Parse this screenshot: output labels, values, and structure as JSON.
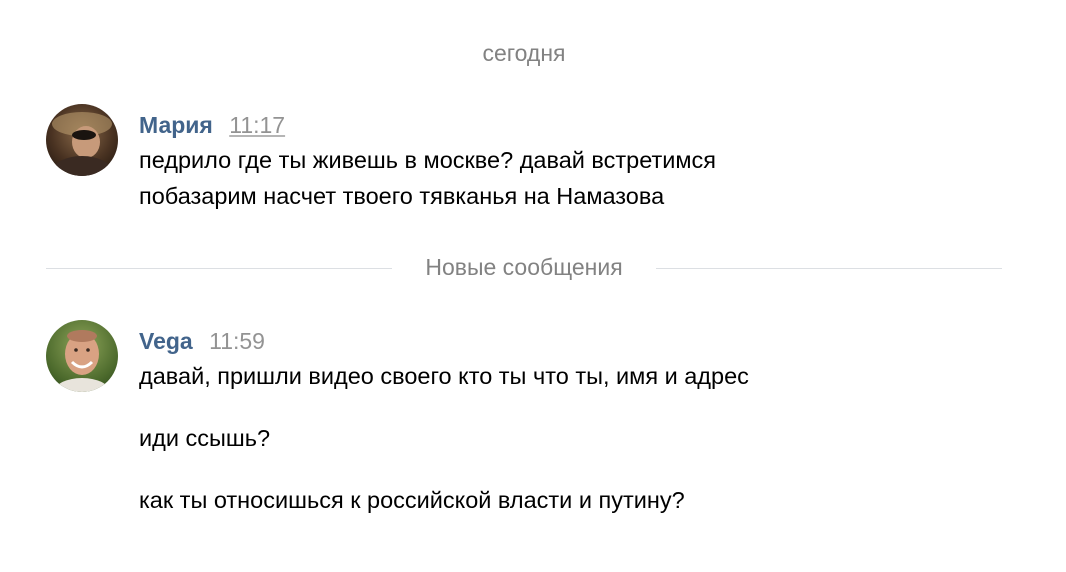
{
  "chat": {
    "date_divider": "сегодня",
    "new_messages_divider": "Новые сообщения",
    "messages": [
      {
        "author": "Мария",
        "time": "11:17",
        "lines": [
          "педрило где ты живешь в москве? давай встретимся",
          "побазарим насчет твоего тявканья на Намазова"
        ]
      },
      {
        "author": "Vega",
        "time": "11:59",
        "lines": [
          "давай, пришли видео своего кто ты что ты, имя и адрес",
          "иди ссышь?",
          "как ты относишься к российской власти и путину?"
        ]
      }
    ]
  },
  "colors": {
    "author": "#42648b",
    "time": "#939393",
    "divider_text": "#828282",
    "divider_line": "#dcdfe3",
    "message_text": "#000000"
  }
}
